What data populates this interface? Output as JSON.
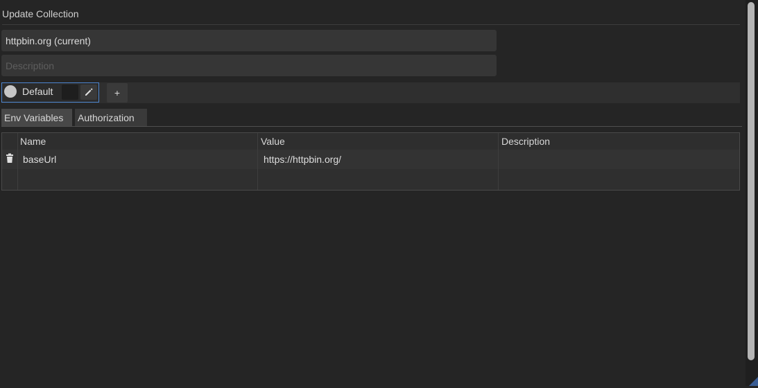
{
  "dialog": {
    "title": "Update Collection"
  },
  "form": {
    "name_value": "httpbin.org (current)",
    "description_placeholder": "Description"
  },
  "environments": {
    "active_label": "Default",
    "add_label": "+"
  },
  "tabs": [
    {
      "label": "Env Variables",
      "active": true
    },
    {
      "label": "Authorization",
      "active": false
    }
  ],
  "table": {
    "columns": [
      "Name",
      "Value",
      "Description"
    ],
    "rows": [
      {
        "name": "baseUrl",
        "value": "https://httpbin.org/",
        "description": ""
      }
    ]
  },
  "colors": {
    "background": "#252525",
    "accent_border": "#4d86d1"
  }
}
